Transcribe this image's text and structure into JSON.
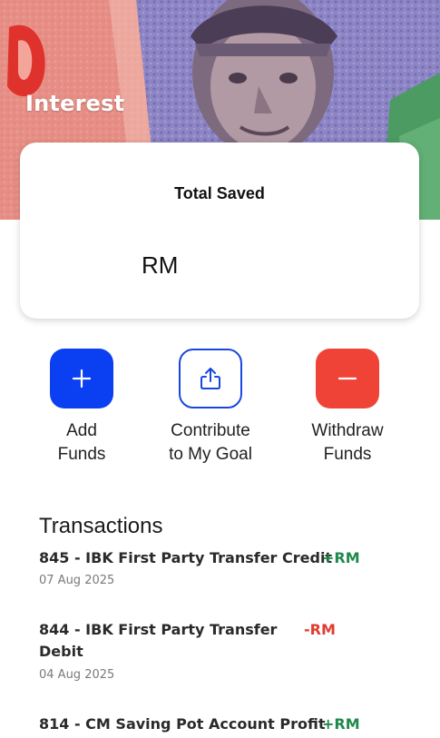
{
  "banner": {
    "interest_text": "Interest"
  },
  "total_card": {
    "title": "Total Saved",
    "currency": "RM"
  },
  "actions": {
    "add": {
      "line1": "Add",
      "line2": "Funds",
      "icon": "plus-icon"
    },
    "contribute": {
      "line1": "Contribute",
      "line2": "to My Goal",
      "icon": "share-icon"
    },
    "withdraw": {
      "line1": "Withdraw",
      "line2": "Funds",
      "icon": "minus-icon"
    }
  },
  "transactions": {
    "heading": "Transactions",
    "items": [
      {
        "line1": "845 - IBK First Party Transfer Credit",
        "line2": "",
        "amount": "+RM",
        "date": "07 Aug 2025",
        "type": "credit"
      },
      {
        "line1": "844 - IBK First Party Transfer",
        "line2": "Debit",
        "amount": "-RM",
        "date": "04 Aug 2025",
        "type": "debit"
      },
      {
        "line1": "814 - CM Saving Pot Account Profit",
        "line2": "",
        "amount": "+RM",
        "date": "",
        "type": "credit"
      }
    ]
  },
  "colors": {
    "add_button": "#0a3ff2",
    "contribute_border": "#1846e0",
    "withdraw_button": "#ef4337",
    "credit_amount": "#1e8a4c",
    "debit_amount": "#e03b30"
  }
}
